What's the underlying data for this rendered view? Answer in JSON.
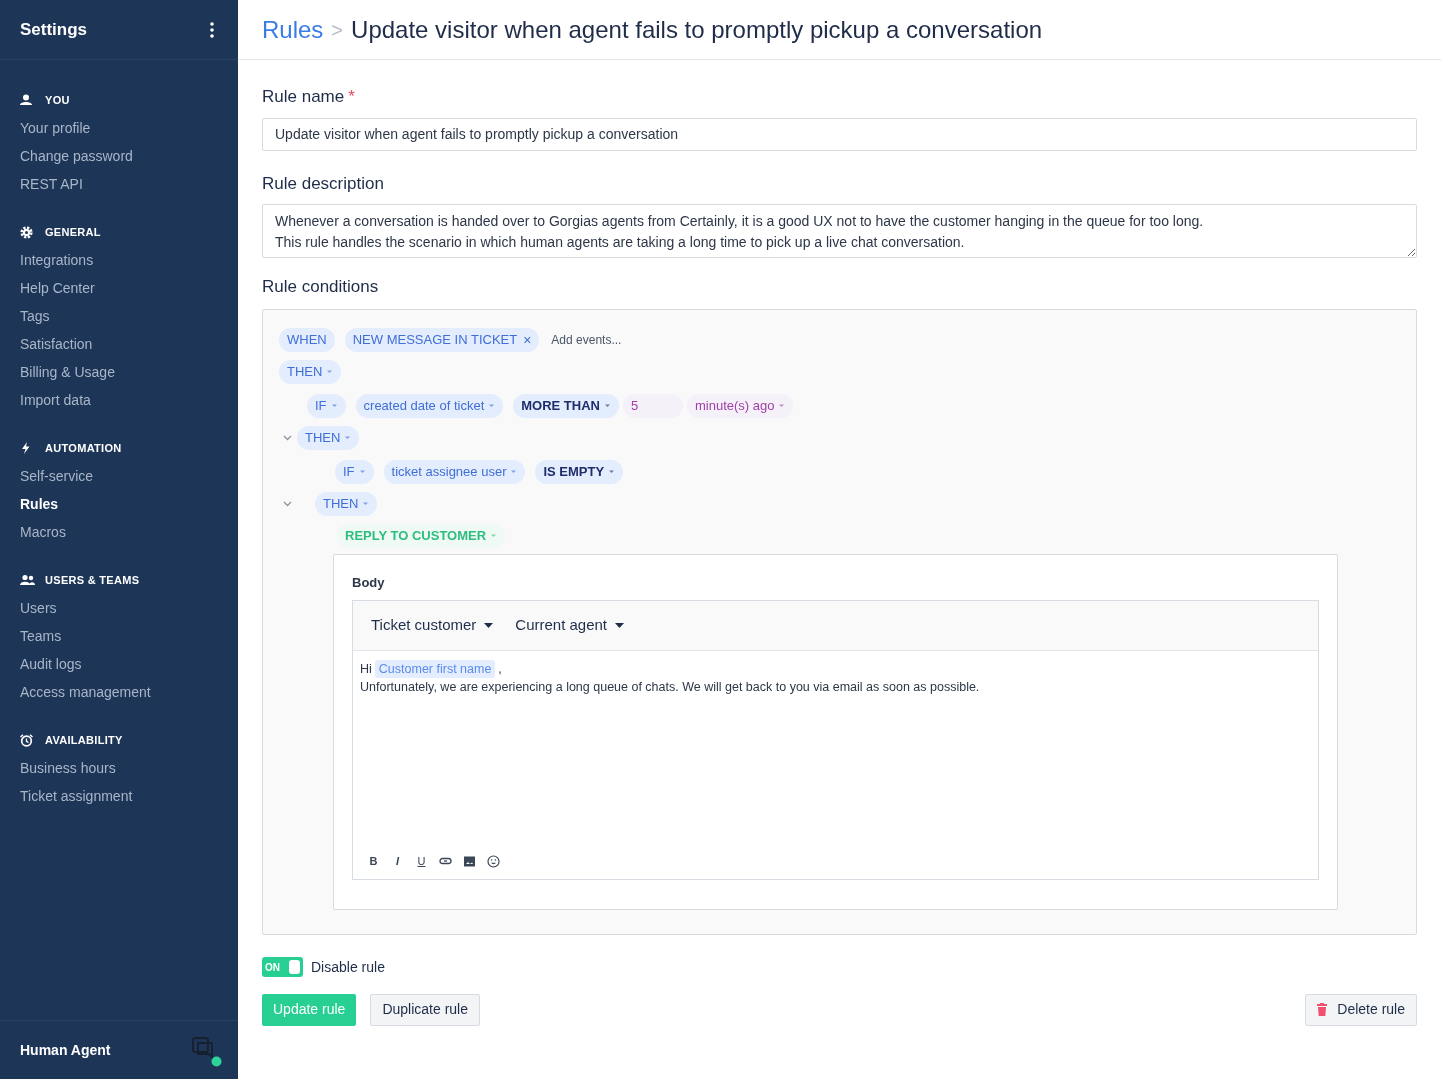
{
  "sidebar": {
    "title": "Settings",
    "sections": [
      {
        "title": "YOU",
        "items": [
          {
            "label": "Your profile",
            "selected": false
          },
          {
            "label": "Change password",
            "selected": false
          },
          {
            "label": "REST API",
            "selected": false
          }
        ]
      },
      {
        "title": "GENERAL",
        "items": [
          {
            "label": "Integrations",
            "selected": false
          },
          {
            "label": "Help Center",
            "selected": false
          },
          {
            "label": "Tags",
            "selected": false
          },
          {
            "label": "Satisfaction",
            "selected": false
          },
          {
            "label": "Billing & Usage",
            "selected": false
          },
          {
            "label": "Import data",
            "selected": false
          }
        ]
      },
      {
        "title": "AUTOMATION",
        "items": [
          {
            "label": "Self-service",
            "selected": false
          },
          {
            "label": "Rules",
            "selected": true
          },
          {
            "label": "Macros",
            "selected": false
          }
        ]
      },
      {
        "title": "USERS & TEAMS",
        "items": [
          {
            "label": "Users",
            "selected": false
          },
          {
            "label": "Teams",
            "selected": false
          },
          {
            "label": "Audit logs",
            "selected": false
          },
          {
            "label": "Access management",
            "selected": false
          }
        ]
      },
      {
        "title": "AVAILABILITY",
        "items": [
          {
            "label": "Business hours",
            "selected": false
          },
          {
            "label": "Ticket assignment",
            "selected": false
          }
        ]
      }
    ],
    "user": {
      "name": "Human Agent"
    }
  },
  "header": {
    "breadcrumb": "Rules",
    "separator": ">",
    "title": "Update visitor when agent fails to promptly pickup a conversation"
  },
  "form": {
    "name_label": "Rule name",
    "required_mark": "*",
    "name_value": "Update visitor when agent fails to promptly pickup a conversation",
    "description_label": "Rule description",
    "description_value": "Whenever a conversation is handed over to Gorgias agents from Certainly, it is a good UX not to have the customer hanging in the queue for too long.\nThis rule handles the scenario in which human agents are taking a long time to pick up a live chat conversation.",
    "conditions_label": "Rule conditions"
  },
  "conditions": {
    "when": {
      "label": "WHEN",
      "events": [
        "NEW MESSAGE IN TICKET"
      ],
      "remove": "×",
      "add_placeholder": "Add events..."
    },
    "tree": {
      "kind": "then",
      "label": "THEN",
      "children": [
        {
          "kind": "if",
          "label": "IF",
          "field": "created date of ticket",
          "operator": "MORE THAN",
          "value": "5",
          "unit": "minute(s) ago"
        },
        {
          "kind": "then",
          "label": "THEN",
          "expanded": true,
          "children": [
            {
              "kind": "if",
              "label": "IF",
              "field": "ticket assignee user",
              "operator": "IS EMPTY"
            },
            {
              "kind": "then",
              "label": "THEN",
              "expanded": true,
              "children": [
                {
                  "kind": "action",
                  "label": "REPLY TO CUSTOMER"
                }
              ]
            }
          ]
        }
      ]
    },
    "editor": {
      "label": "Body",
      "variables": [
        "Ticket customer",
        "Current agent"
      ],
      "lines": [
        [
          {
            "kind": "text",
            "text": "Hi"
          },
          {
            "kind": "variable",
            "text": "Customer first name"
          },
          {
            "kind": "text",
            "text": ","
          }
        ],
        [
          {
            "kind": "text",
            "text": "Unfortunately, we are experiencing a long queue of chats. We will get back to you via email as soon as possible."
          }
        ]
      ],
      "toolbar": [
        {
          "kind": "bold",
          "label": "B"
        },
        {
          "kind": "italic",
          "label": "I"
        },
        {
          "kind": "underline",
          "label": "U"
        },
        {
          "kind": "link"
        },
        {
          "kind": "image"
        },
        {
          "kind": "emoji"
        }
      ]
    }
  },
  "toggle": {
    "on": true,
    "state_label": "ON",
    "label": "Disable rule"
  },
  "buttons": {
    "update": "Update rule",
    "duplicate": "Duplicate rule",
    "delete": "Delete rule"
  }
}
